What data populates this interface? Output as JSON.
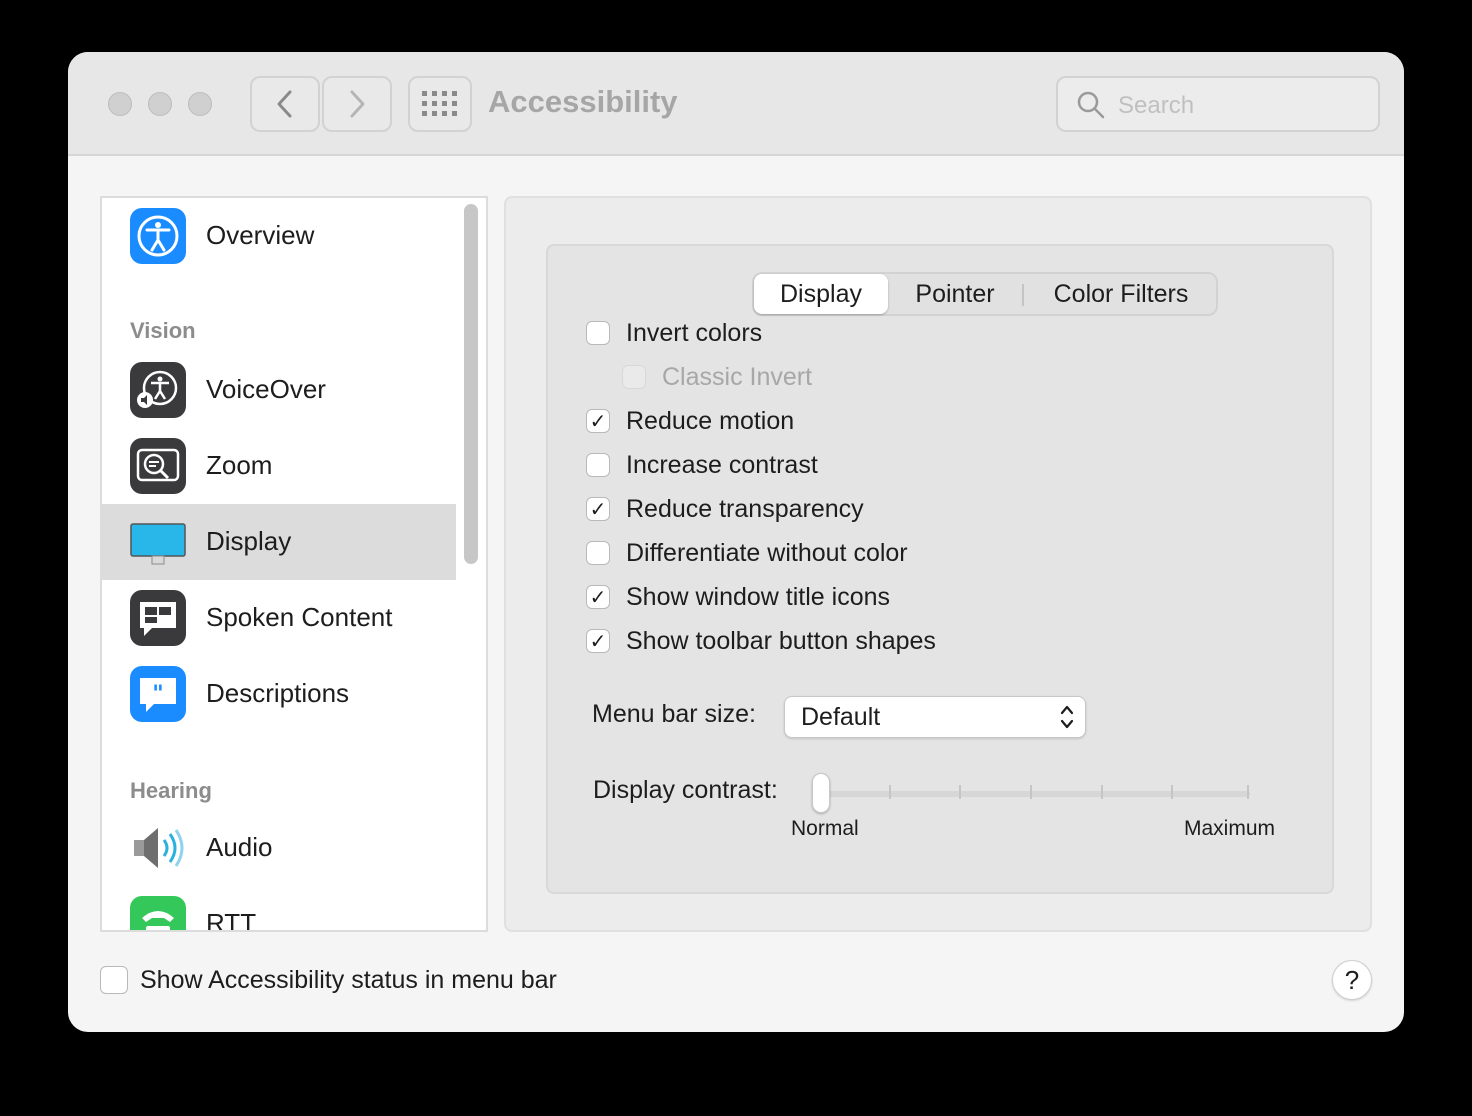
{
  "window": {
    "title": "Accessibility"
  },
  "toolbar": {
    "search_placeholder": "Search"
  },
  "sidebar": {
    "items": [
      {
        "label": "Overview",
        "icon": "accessibility-icon",
        "color": "#1a8cff"
      },
      {
        "section": "Vision"
      },
      {
        "label": "VoiceOver",
        "icon": "voiceover-icon",
        "color": "#3a3a3c"
      },
      {
        "label": "Zoom",
        "icon": "zoom-icon",
        "color": "#3a3a3c"
      },
      {
        "label": "Display",
        "icon": "display-icon",
        "color": "#28b7e8",
        "selected": true
      },
      {
        "label": "Spoken Content",
        "icon": "spoken-content-icon",
        "color": "#3a3a3c"
      },
      {
        "label": "Descriptions",
        "icon": "descriptions-icon",
        "color": "#1a8cff"
      },
      {
        "section": "Hearing"
      },
      {
        "label": "Audio",
        "icon": "speaker-icon",
        "color": "#8e8e93"
      },
      {
        "label": "RTT",
        "icon": "rtt-icon",
        "color": "#34c759"
      }
    ]
  },
  "tabs": [
    {
      "label": "Display",
      "active": true
    },
    {
      "label": "Pointer"
    },
    {
      "label": "Color Filters"
    }
  ],
  "display_options": [
    {
      "label": "Invert colors",
      "checked": false
    },
    {
      "label": "Classic Invert",
      "checked": false,
      "disabled": true
    },
    {
      "label": "Reduce motion",
      "checked": true
    },
    {
      "label": "Increase contrast",
      "checked": false
    },
    {
      "label": "Reduce transparency",
      "checked": true
    },
    {
      "label": "Differentiate without color",
      "checked": false
    },
    {
      "label": "Show window title icons",
      "checked": true
    },
    {
      "label": "Show toolbar button shapes",
      "checked": true
    }
  ],
  "menu_bar_size": {
    "label": "Menu bar size:",
    "value": "Default"
  },
  "display_contrast": {
    "label": "Display contrast:",
    "min_label": "Normal",
    "max_label": "Maximum",
    "value": 0
  },
  "footer": {
    "status_label": "Show Accessibility status in menu bar",
    "checked": false,
    "help": "?"
  },
  "check_glyph": "✓"
}
